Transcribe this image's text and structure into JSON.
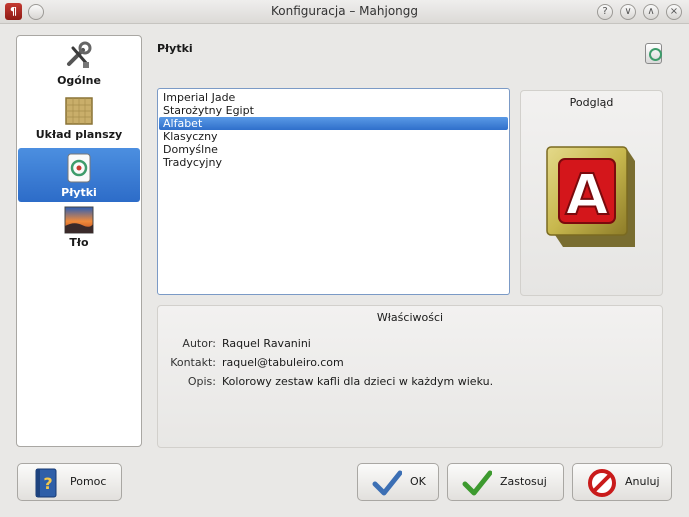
{
  "window": {
    "title": "Konfiguracja – Mahjongg",
    "app_icon_glyph": "¶",
    "buttons": [
      "?",
      "∨",
      "∧",
      "×"
    ]
  },
  "sidebar": {
    "items": [
      {
        "label": "Ogólne",
        "icon": "settings-tools-icon",
        "selected": false
      },
      {
        "label": "Układ planszy",
        "icon": "board-layout-icon",
        "selected": false
      },
      {
        "label": "Płytki",
        "icon": "tile-icon",
        "selected": true
      },
      {
        "label": "Tło",
        "icon": "background-image-icon",
        "selected": false
      }
    ]
  },
  "page": {
    "title": "Płytki",
    "icon": "tile-icon"
  },
  "tiles": {
    "items": [
      "Imperial Jade",
      "Starożytny Egipt",
      "Alfabet",
      "Klasyczny",
      "Domyślne",
      "Tradycyjny"
    ],
    "selected": "Alfabet"
  },
  "preview": {
    "title": "Podgląd",
    "tile_letter": "A"
  },
  "properties": {
    "title": "Właściwości",
    "author_label": "Autor:",
    "author_value": "Raquel Ravanini",
    "contact_label": "Kontakt:",
    "contact_value": "raquel@tabuleiro.com",
    "description_label": "Opis:",
    "description_value": "Kolorowy zestaw kafli dla dzieci w każdym wieku."
  },
  "buttons": {
    "help": "Pomoc",
    "ok": "OK",
    "apply": "Zastosuj",
    "cancel": "Anuluj"
  },
  "colors": {
    "selection": "#2f6fcb",
    "tile_red": "#d4161b",
    "tile_wood": "#c8b84e"
  }
}
